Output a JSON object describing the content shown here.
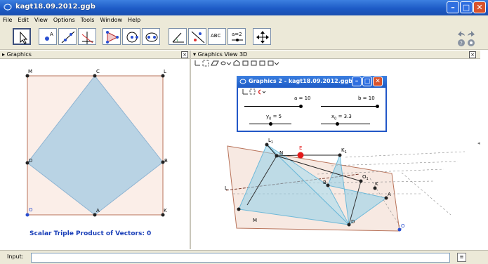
{
  "window": {
    "title": "kagt18.09.2012.ggb"
  },
  "menu": [
    "File",
    "Edit",
    "View",
    "Options",
    "Tools",
    "Window",
    "Help"
  ],
  "toolbar": {
    "text_tool_label": "ABC",
    "slider_tool_label": "a=2"
  },
  "graphics": {
    "title": "Graphics",
    "points": {
      "M": "M",
      "C": "C",
      "L": "L",
      "D": "D",
      "B": "B",
      "O": "O",
      "A": "A",
      "K": "K"
    },
    "caption": "Scalar Triple Product of Vectors: 0",
    "colors": {
      "fill": "#b9d3e4",
      "edge": "#8fb4d2",
      "square": "#b8735a",
      "caption": "#1a3fb8"
    }
  },
  "graphics3d": {
    "title": "Graphics View 3D",
    "labels": {
      "L1": "L",
      "L1_sub": "1",
      "N": "N",
      "E": "E",
      "K1": "K",
      "K1_sub": "1",
      "O1": "O",
      "O1_sub": "1",
      "L": "L",
      "B": "B",
      "K": "K",
      "A": "A",
      "M": "M",
      "D": "D",
      "O": "O"
    }
  },
  "dialog": {
    "title": "Graphics 2 - kagt18.09.2012.ggb",
    "sliders": {
      "a": "a = 10",
      "b": "b = 10",
      "y0_var": "y",
      "y0_sub": "0",
      "y0_val": " = 5",
      "x0_var": "x",
      "x0_sub": "0",
      "x0_val": " = 3.3"
    }
  },
  "input": {
    "label": "Input:"
  }
}
